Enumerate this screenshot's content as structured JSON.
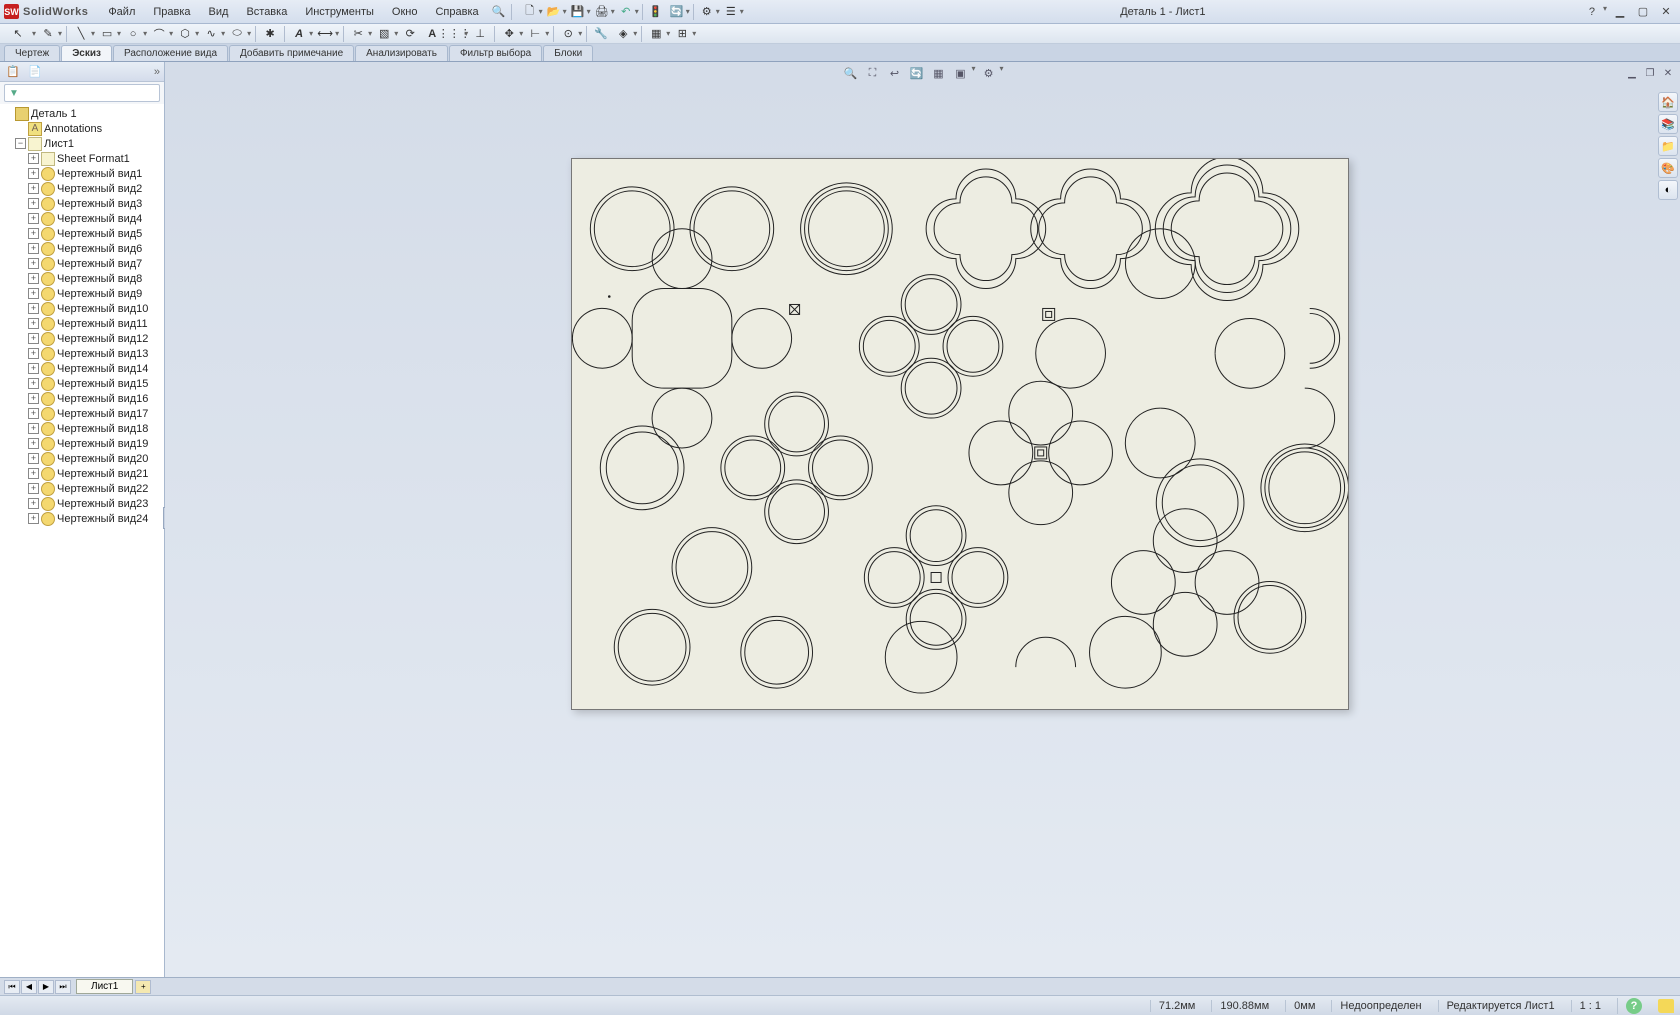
{
  "app": {
    "name": "SolidWorks",
    "title": "Деталь 1 - Лист1"
  },
  "menu": [
    "Файл",
    "Правка",
    "Вид",
    "Вставка",
    "Инструменты",
    "Окно",
    "Справка"
  ],
  "tabs": [
    "Чертеж",
    "Эскиз",
    "Расположение вида",
    "Добавить примечание",
    "Анализировать",
    "Фильтр выбора",
    "Блоки"
  ],
  "tree_root": "Деталь 1",
  "tree_ann": "Annotations",
  "tree_sheet": "Лист1",
  "tree_format": "Sheet Format1",
  "views": [
    "Чертежный вид1",
    "Чертежный вид2",
    "Чертежный вид3",
    "Чертежный вид4",
    "Чертежный вид5",
    "Чертежный вид6",
    "Чертежный вид7",
    "Чертежный вид8",
    "Чертежный вид9",
    "Чертежный вид10",
    "Чертежный вид11",
    "Чертежный вид12",
    "Чертежный вид13",
    "Чертежный вид14",
    "Чертежный вид15",
    "Чертежный вид16",
    "Чертежный вид17",
    "Чертежный вид18",
    "Чертежный вид19",
    "Чертежный вид20",
    "Чертежный вид21",
    "Чертежный вид22",
    "Чертежный вид23",
    "Чертежный вид24"
  ],
  "sheet_tab": "Лист1",
  "status": {
    "x": "71.2мм",
    "y": "190.88мм",
    "z": "0мм",
    "constraint": "Недоопределен",
    "edit": "Редактируется Лист1",
    "scale": "1 : 1"
  }
}
